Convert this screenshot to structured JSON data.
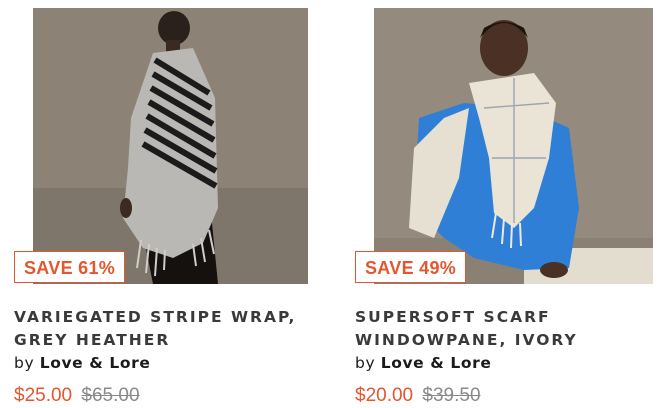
{
  "products": [
    {
      "badge": "SAVE 61%",
      "title": "VARIEGATED STRIPE WRAP, GREY HEATHER",
      "by": "by",
      "brand": "Love & Lore",
      "price": "$25.00",
      "original_price": "$65.00",
      "image_alt": "Model wearing grey striped wrap"
    },
    {
      "badge": "SAVE 49%",
      "title": "SUPERSOFT SCARF WINDOWPANE, IVORY",
      "by": "by",
      "brand": "Love & Lore",
      "price": "$20.00",
      "original_price": "$39.50",
      "image_alt": "Model wearing ivory windowpane scarf with blue sweater"
    }
  ],
  "colors": {
    "accent": "#e4572e",
    "muted_price": "#8a8a8a",
    "title_text": "#3a3a3a"
  }
}
